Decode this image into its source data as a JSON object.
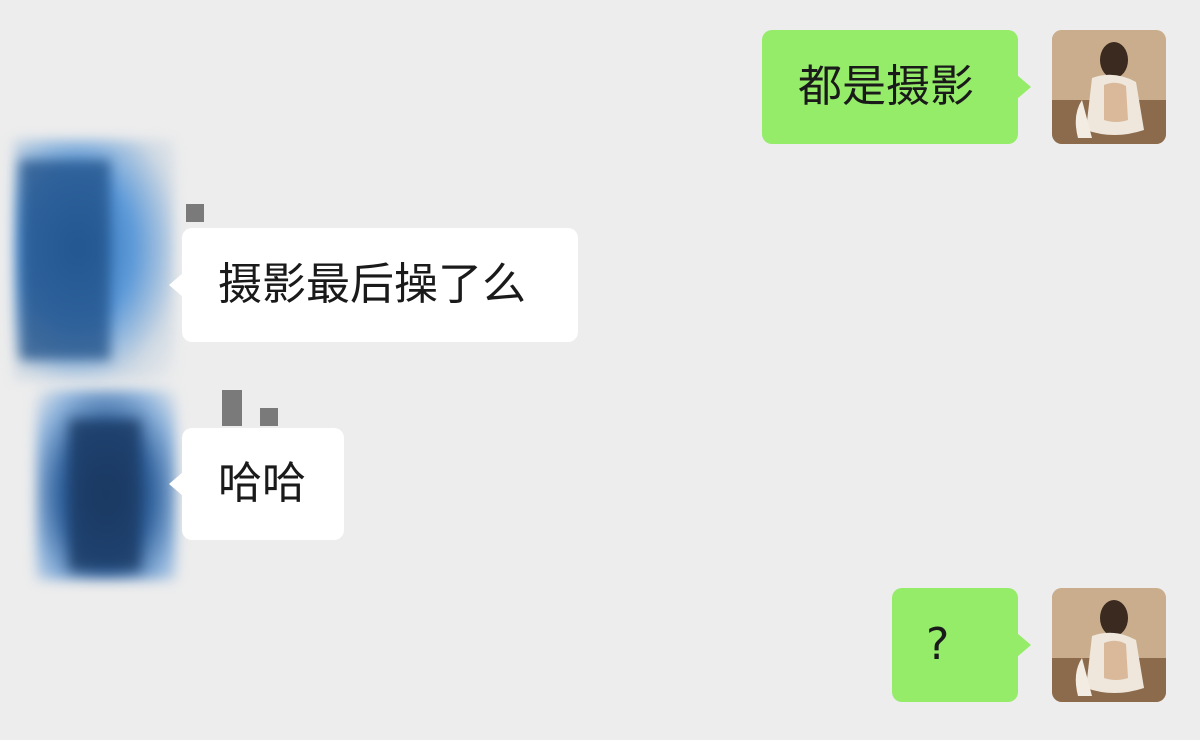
{
  "messages": [
    {
      "id": "m1",
      "direction": "sent",
      "text": "都是摄影"
    },
    {
      "id": "m2",
      "direction": "received",
      "text": "摄影最后操了么"
    },
    {
      "id": "m3",
      "direction": "received",
      "text": "哈哈"
    },
    {
      "id": "m4",
      "direction": "sent",
      "text": "?"
    }
  ],
  "colors": {
    "background": "#ededed",
    "sent_bubble": "#95ec69",
    "received_bubble": "#ffffff",
    "text": "#1a1a1a"
  },
  "icons": {
    "self_avatar": "user-photo-avatar",
    "contact_avatar": "redacted-avatar"
  }
}
